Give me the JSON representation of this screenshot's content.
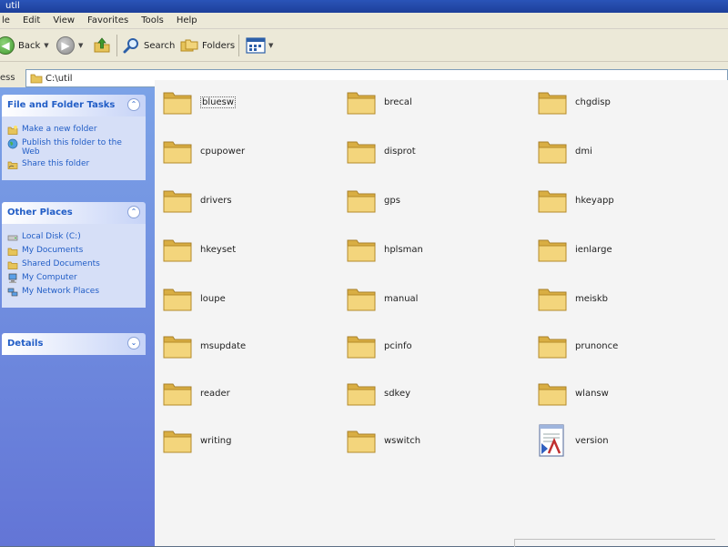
{
  "window": {
    "title": "util"
  },
  "menu": {
    "items": [
      "le",
      "Edit",
      "View",
      "Favorites",
      "Tools",
      "Help"
    ]
  },
  "toolbar": {
    "back": "Back",
    "search": "Search",
    "folders": "Folders"
  },
  "address": {
    "label": "ess",
    "path": "C:\\util"
  },
  "tasks_panel": {
    "title": "File and Folder Tasks",
    "items": [
      "Make a new folder",
      "Publish this folder to the Web",
      "Share this folder"
    ]
  },
  "places_panel": {
    "title": "Other Places",
    "items": [
      "Local Disk (C:)",
      "My Documents",
      "Shared Documents",
      "My Computer",
      "My Network Places"
    ]
  },
  "details_panel": {
    "title": "Details"
  },
  "files": [
    {
      "name": "bluesw",
      "type": "folder"
    },
    {
      "name": "brecal",
      "type": "folder"
    },
    {
      "name": "chgdisp",
      "type": "folder"
    },
    {
      "name": "cpupower",
      "type": "folder"
    },
    {
      "name": "disprot",
      "type": "folder"
    },
    {
      "name": "dmi",
      "type": "folder"
    },
    {
      "name": "drivers",
      "type": "folder"
    },
    {
      "name": "gps",
      "type": "folder"
    },
    {
      "name": "hkeyapp",
      "type": "folder"
    },
    {
      "name": "hkeyset",
      "type": "folder"
    },
    {
      "name": "hplsman",
      "type": "folder"
    },
    {
      "name": "ienlarge",
      "type": "folder"
    },
    {
      "name": "loupe",
      "type": "folder"
    },
    {
      "name": "manual",
      "type": "folder"
    },
    {
      "name": "meiskb",
      "type": "folder"
    },
    {
      "name": "msupdate",
      "type": "folder"
    },
    {
      "name": "pcinfo",
      "type": "folder"
    },
    {
      "name": "prunonce",
      "type": "folder"
    },
    {
      "name": "reader",
      "type": "folder"
    },
    {
      "name": "sdkey",
      "type": "folder"
    },
    {
      "name": "wlansw",
      "type": "folder"
    },
    {
      "name": "writing",
      "type": "folder"
    },
    {
      "name": "wswitch",
      "type": "folder"
    },
    {
      "name": "version",
      "type": "document"
    }
  ]
}
